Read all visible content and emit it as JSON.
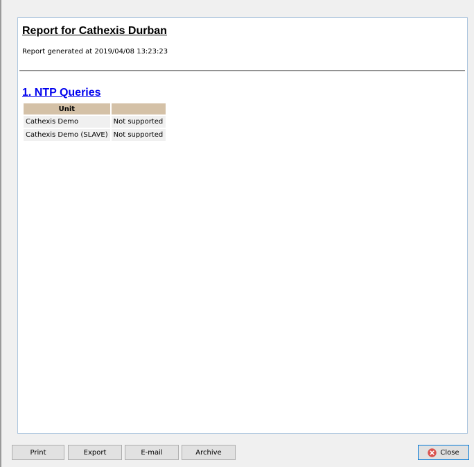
{
  "report": {
    "title": "Report for Cathexis Durban",
    "generated": "Report generated at 2019/04/08 13:23:23"
  },
  "section": {
    "heading": "1. NTP Queries",
    "table": {
      "headers": [
        "Unit",
        ""
      ],
      "rows": [
        [
          "Cathexis Demo",
          "Not supported"
        ],
        [
          "Cathexis Demo (SLAVE)",
          "Not supported"
        ]
      ]
    }
  },
  "buttons": {
    "print": "Print",
    "export": "Export",
    "email": "E-mail",
    "archive": "Archive",
    "close": "Close"
  },
  "icons": {
    "close": "close-circle-icon"
  },
  "colors": {
    "table_header_bg": "#d4c1a7",
    "link_blue": "#0000ee",
    "close_icon_red": "#d9534f",
    "focus_border": "#0078d7"
  }
}
